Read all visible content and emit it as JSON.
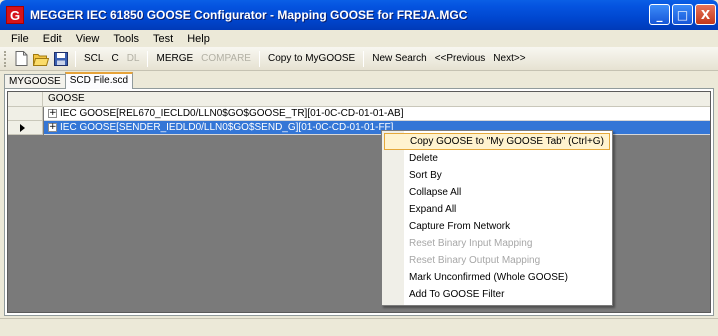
{
  "window": {
    "app_icon_letter": "G",
    "title": "MEGGER  IEC 61850 GOOSE Configurator - Mapping GOOSE for FREJA.MGC",
    "buttons": [
      "_",
      "□",
      "X"
    ]
  },
  "menu": [
    "File",
    "Edit",
    "View",
    "Tools",
    "Test",
    "Help"
  ],
  "toolbar": {
    "new_icon": "new-file-icon",
    "open_icon": "open-folder-icon",
    "save_icon": "save-icon",
    "scl": "SCL",
    "c": "C",
    "dl": "DL",
    "merge": "MERGE",
    "compare": "COMPARE",
    "copy_to_mygoose": "Copy to MyGOOSE",
    "new_search": "New Search",
    "previous": "<<Previous",
    "next": "Next>>"
  },
  "tabs": [
    {
      "label": "MYGOOSE",
      "active": false
    },
    {
      "label": "SCD File.scd",
      "active": true
    }
  ],
  "grid": {
    "column_header": "GOOSE",
    "rows": [
      {
        "text": "IEC GOOSE[REL670_IECLD0/LLN0$GO$GOOSE_TR][01-0C-CD-01-01-AB]",
        "selected": false
      },
      {
        "text": "IEC GOOSE[SENDER_IEDLD0/LLN0$GO$SEND_G][01-0C-CD-01-01-FF]",
        "selected": true
      }
    ]
  },
  "context_menu": [
    {
      "label": "Copy GOOSE to \"My GOOSE Tab\" (Ctrl+G)",
      "enabled": true,
      "highlighted": true
    },
    {
      "label": "Delete",
      "enabled": true
    },
    {
      "label": "Sort By",
      "enabled": true
    },
    {
      "label": "Collapse All",
      "enabled": true
    },
    {
      "label": "Expand All",
      "enabled": true
    },
    {
      "label": "Capture From Network",
      "enabled": true
    },
    {
      "label": "Reset Binary Input Mapping",
      "enabled": false
    },
    {
      "label": "Reset Binary Output Mapping",
      "enabled": false
    },
    {
      "label": "Mark Unconfirmed (Whole GOOSE)",
      "enabled": true
    },
    {
      "label": "Add To GOOSE Filter",
      "enabled": true
    }
  ],
  "colors": {
    "titlebar": "#0047d0",
    "selection": "#3476d6",
    "menu_highlight": "#fff3cf"
  }
}
